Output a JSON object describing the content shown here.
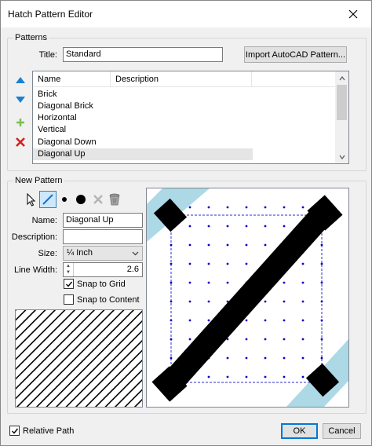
{
  "window": {
    "title": "Hatch Pattern Editor"
  },
  "patterns_group": {
    "legend": "Patterns",
    "title_label": "Title:",
    "title_value": "Standard",
    "import_button": "Import AutoCAD Pattern...",
    "columns": [
      "Name",
      "Description"
    ],
    "items": [
      {
        "name": "Brick",
        "description": ""
      },
      {
        "name": "Diagonal Brick",
        "description": ""
      },
      {
        "name": "Horizontal",
        "description": ""
      },
      {
        "name": "Vertical",
        "description": ""
      },
      {
        "name": "Diagonal Down",
        "description": ""
      },
      {
        "name": "Diagonal Up",
        "description": ""
      }
    ],
    "selected_item": "Diagonal Up"
  },
  "new_pattern_group": {
    "legend": "New Pattern",
    "name_label": "Name:",
    "name_value": "Diagonal Up",
    "description_label": "Description:",
    "description_value": "",
    "size_label": "Size:",
    "size_value": "¼ Inch",
    "line_width_label": "Line Width:",
    "line_width_value": "2.6",
    "snap_to_grid_label": "Snap to Grid",
    "snap_to_grid_checked": true,
    "snap_to_content_label": "Snap to Content",
    "snap_to_content_checked": false
  },
  "footer": {
    "relative_path_label": "Relative Path",
    "relative_path_checked": true,
    "ok_button": "OK",
    "cancel_button": "Cancel"
  },
  "icons": {
    "move_up": "arrow-up-icon",
    "move_down": "arrow-down-icon",
    "add": "plus-icon",
    "delete": "red-x-icon",
    "select_tool": "pointer-icon",
    "line_tool": "line-icon",
    "small_dot_tool": "small-dot-icon",
    "large_dot_tool": "large-dot-icon",
    "delete_tool": "gray-x-icon",
    "clear_tool": "trash-icon"
  },
  "colors": {
    "accent": "#0078d7",
    "guide_band": "#add8e6",
    "grid_dot": "#0000cc"
  }
}
